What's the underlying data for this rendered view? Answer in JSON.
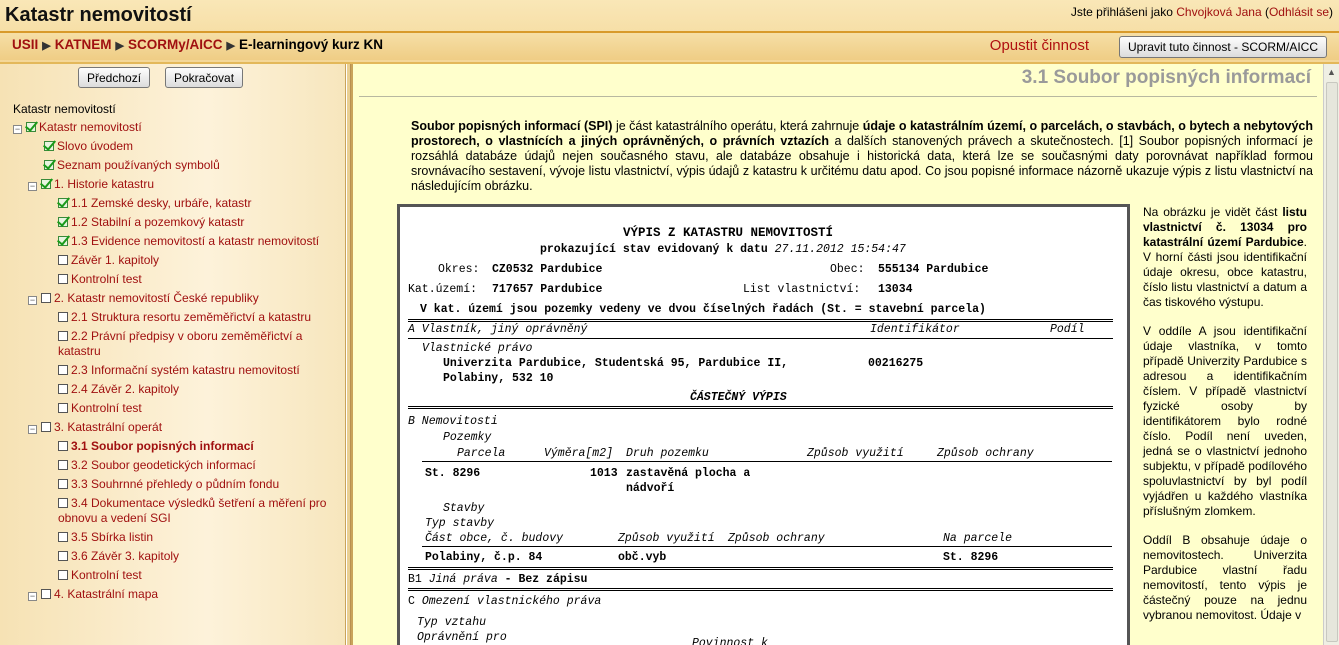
{
  "header": {
    "title": "Katastr nemovitostí",
    "login_prefix": "Jste přihlášeni jako",
    "user_name": "Chvojková Jana",
    "logout_label": "Odhlásit se"
  },
  "breadcrumb": {
    "items": [
      "USII",
      "KATNEM",
      "SCORMy/AICC"
    ],
    "current": "E-learningový kurz KN"
  },
  "actions": {
    "leave_label": "Opustit činnost",
    "edit_label": "Upravit tuto činnost - SCORM/AICC"
  },
  "nav": {
    "prev_label": "Předchozí",
    "next_label": "Pokračovat"
  },
  "toc": {
    "root": "Katastr nemovitostí",
    "items": [
      {
        "label": "Katastr nemovitostí"
      },
      {
        "label": "Slovo úvodem"
      },
      {
        "label": "Seznam používaných symbolů"
      },
      {
        "label": "1. Historie katastru"
      },
      {
        "label": "1.1 Zemské desky, urbáře, katastr"
      },
      {
        "label": "1.2 Stabilní a pozemkový katastr"
      },
      {
        "label": "1.3 Evidence nemovitostí a katastr nemovitostí"
      },
      {
        "label": "Závěr 1. kapitoly"
      },
      {
        "label": "Kontrolní test"
      },
      {
        "label": "2. Katastr nemovitostí České republiky"
      },
      {
        "label": "2.1 Struktura resortu zeměměřictví a katastru"
      },
      {
        "label": "2.2 Právní předpisy v oboru zeměměřictví a katastru"
      },
      {
        "label": "2.3 Informační systém katastru nemovitostí"
      },
      {
        "label": "2.4 Závěr 2. kapitoly"
      },
      {
        "label": "Kontrolní test"
      },
      {
        "label": "3. Katastrální operát"
      },
      {
        "label": "3.1 Soubor popisných informací"
      },
      {
        "label": "3.2 Soubor geodetických informací"
      },
      {
        "label": "3.3 Souhrnné přehledy o půdním fondu"
      },
      {
        "label": "3.4 Dokumentace výsledků šetření a měření pro obnovu a vedení SGI"
      },
      {
        "label": "3.5 Sbírka listin"
      },
      {
        "label": "3.6 Závěr 3. kapitoly"
      },
      {
        "label": "Kontrolní test"
      },
      {
        "label": "4. Katastrální mapa"
      }
    ]
  },
  "content": {
    "section_title": "3.1 Soubor popisných informací",
    "intro_b1": "Soubor popisných informací (SPI)",
    "intro_t1": " je část katastrálního operátu, která zahrnuje ",
    "intro_b2": "údaje o katastrálním území, o parcelách, o stavbách, o bytech a nebytových prostorech, o vlastnících a jiných oprávněných, o právních vztazích",
    "intro_t2": " a dalších stanovených právech a skutečnostech. [1] Soubor popisných informací je rozsáhlá databáze údajů nejen současného stavu, ale databáze obsahuje i historická data, která lze se současnými daty porovnávat například formou srovnávacího sestavení, vývoje listu vlastnictví, výpis údajů z katastru k určitému datu apod. Co jsou popisné informace názorně ukazuje výpis z listu vlastnictví na následujícím obrázku."
  },
  "extract": {
    "title": "VÝPIS Z KATASTRU NEMOVITOSTÍ",
    "subtitle_prefix": "prokazující stav evidovaný k datu",
    "date": "27.11.2012 15:54:47",
    "okres_label": "Okres:",
    "okres_value": "CZ0532 Pardubice",
    "obec_label": "Obec:",
    "obec_value": "555134 Pardubice",
    "katuzemi_label": "Kat.území:",
    "katuzemi_value": "717657 Pardubice",
    "lv_label": "List vlastnictví:",
    "lv_value": "13034",
    "note": "V kat. území jsou pozemky vedeny ve dvou číselných řadách   (St. = stavební parcela)",
    "secA": "A Vlastník, jiný oprávněný",
    "identifikator": "Identifikátor",
    "podil": "Podíl",
    "vlastnicke_pravo": "Vlastnické právo",
    "owner1": "Univerzita Pardubice, Studentská 95, Pardubice II,",
    "owner_id": "00216275",
    "owner2": "Polabiny, 532 10",
    "partial": "ČÁSTEČNÝ VÝPIS",
    "secB": "B Nemovitosti",
    "pozemky": "Pozemky",
    "col_parcela": "Parcela",
    "col_vymera": "Výměra[m2]",
    "col_druh": "Druh pozemku",
    "col_zpusob_vyuziti": "Způsob využití",
    "col_zpusob_ochrany": "Způsob ochrany",
    "row_parcela": "St. 8296",
    "row_vymera": "1013",
    "row_druh1": "zastavěná plocha a",
    "row_druh2": "nádvoří",
    "stavby": "Stavby",
    "typ_stavby": "Typ stavby",
    "col_cast_obce": "Část obce, č. budovy",
    "col_sv": "Způsob využití",
    "col_so": "Způsob ochrany",
    "col_na_parcele": "Na parcele",
    "st_cast": "Polabiny, č.p. 84",
    "st_vyuziti": "obč.vyb",
    "st_parcela": "St. 8296",
    "secB1": "B1",
    "jina_prava": "Jiná práva",
    "bez_zapisu": "- Bez zápisu",
    "secC": "C",
    "omezeni": "Omezení vlastnického práva",
    "typ_vztahu": "Typ vztahu",
    "opravneni": "Oprávnění pro",
    "povinnost": "Povinnost k"
  },
  "sidebar": {
    "p1_t1": "Na obrázku je vidět část ",
    "p1_b1": "listu vlastnictví č. 13034 pro katastrální území Pardubice",
    "p1_t2": ". V horní části jsou identifikační údaje okresu, obce katastru, číslo listu vlastnictví a datum a čas tiskového výstupu.",
    "p2": "V oddíle A jsou identifikační údaje vlastníka, v tomto případě Univerzity Pardubice s adresou a identifikačním číslem. V případě vlastnictví fyzické osoby by identifikátorem bylo rodné číslo. Podíl není uveden, jedná se o vlastnictví jednoho subjektu, v případě podílového spoluvlastnictví by byl podíl vyjádřen u každého vlastníka příslušným zlomkem.",
    "p3": "Oddíl B obsahuje údaje o nemovitostech. Univerzita Pardubice vlastní řadu nemovitostí, tento výpis je částečný pouze na jednu vybranou nemovitost. Údaje v"
  }
}
